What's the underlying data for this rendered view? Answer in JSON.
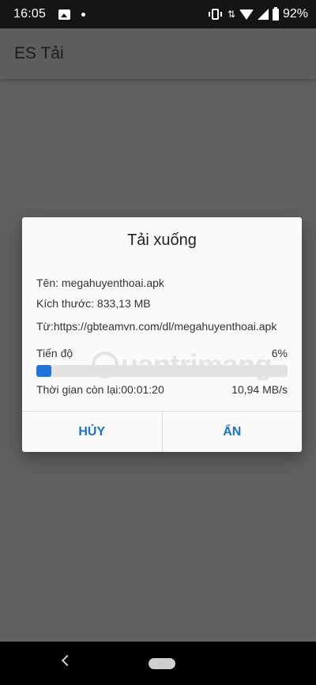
{
  "status_bar": {
    "time": "16:05",
    "battery": "92%",
    "icons": [
      "image-icon",
      "dot-icon",
      "vibrate-icon",
      "data-arrows-icon",
      "wifi-icon",
      "signal-icon",
      "battery-icon"
    ]
  },
  "app_bar": {
    "title": "ES Tải"
  },
  "dialog": {
    "title": "Tải xuống",
    "name_line": "Tên: megahuyenthoai.apk",
    "size_line": "Kích thước: 833,13 MB",
    "from_line": "Từ:https://gbteamvn.com/dl/megahuyenthoai.apk",
    "progress_label": "Tiến độ",
    "progress_percent_text": "6%",
    "progress_fraction": 0.06,
    "time_left": "Thời gian còn lại:00:01:20",
    "speed": "10,94 MB/s",
    "cancel_label": "HỦY",
    "hide_label": "ẨN",
    "accent_color": "#1e73de"
  },
  "watermark": {
    "text": "uantrimang"
  }
}
